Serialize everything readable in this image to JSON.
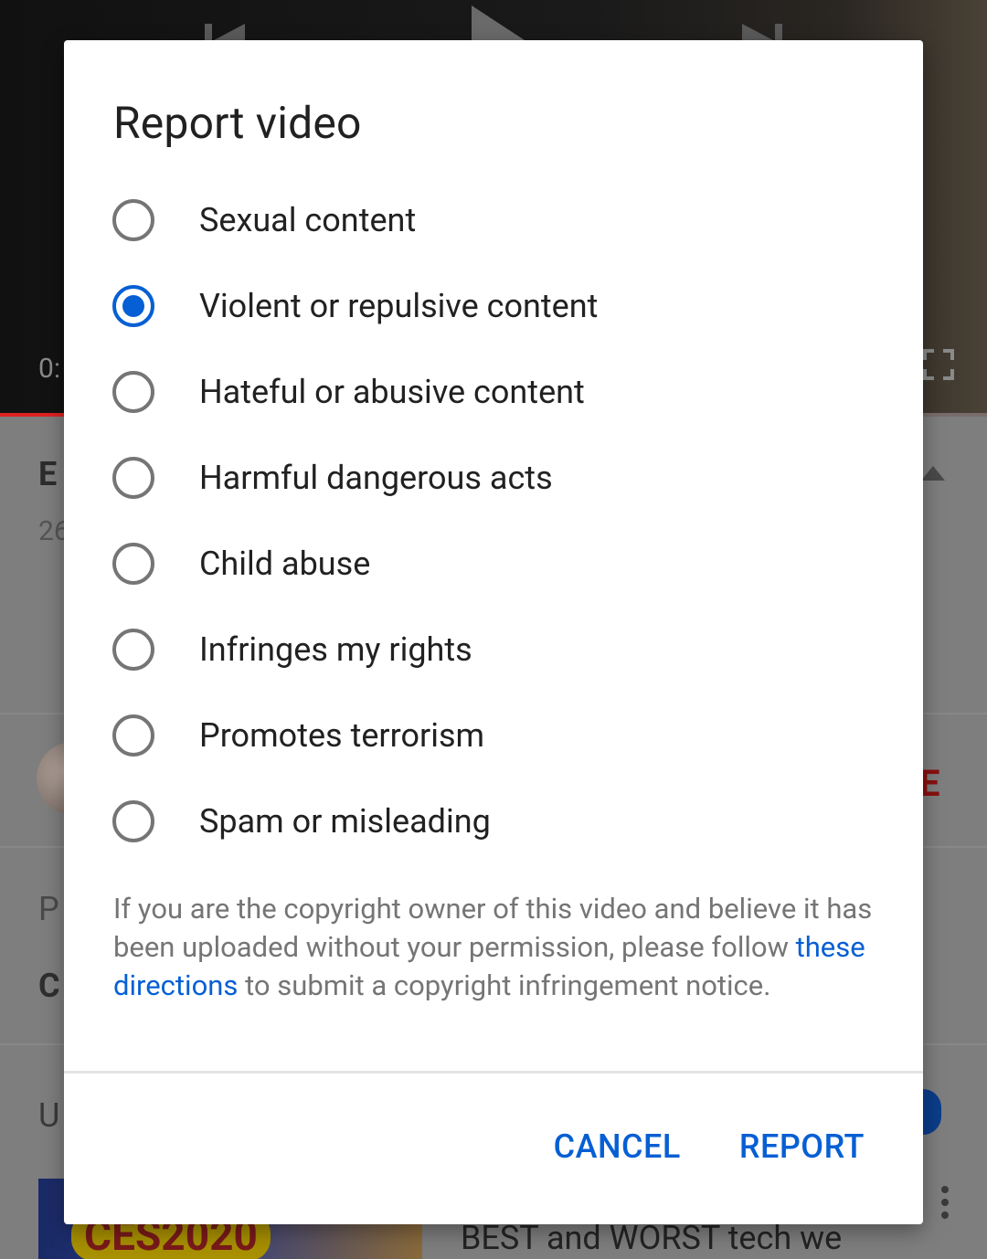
{
  "background": {
    "time_text": "0:",
    "title_fragment": "E",
    "views_fragment": "26",
    "subscribe_fragment": "E",
    "row1_fragment": "P",
    "row2_fragment": "C",
    "upnext_fragment": "U",
    "thumb_badge": "CES2020",
    "next_video_title": "BEST and WORST tech we"
  },
  "dialog": {
    "title": "Report video",
    "options": [
      {
        "label": "Sexual content",
        "selected": false
      },
      {
        "label": "Violent or repulsive content",
        "selected": true
      },
      {
        "label": "Hateful or abusive content",
        "selected": false
      },
      {
        "label": "Harmful dangerous acts",
        "selected": false
      },
      {
        "label": "Child abuse",
        "selected": false
      },
      {
        "label": "Infringes my rights",
        "selected": false
      },
      {
        "label": "Promotes terrorism",
        "selected": false
      },
      {
        "label": "Spam or misleading",
        "selected": false
      }
    ],
    "notice_before": "If you are the copyright owner of this video and believe it has been uploaded without your permission, please follow ",
    "notice_link": "these directions",
    "notice_after": " to submit a copyright infringement notice.",
    "cancel_label": "CANCEL",
    "report_label": "REPORT"
  },
  "colors": {
    "accent": "#065fd4",
    "radio_unselected": "#757575",
    "notice_text": "#757575"
  }
}
